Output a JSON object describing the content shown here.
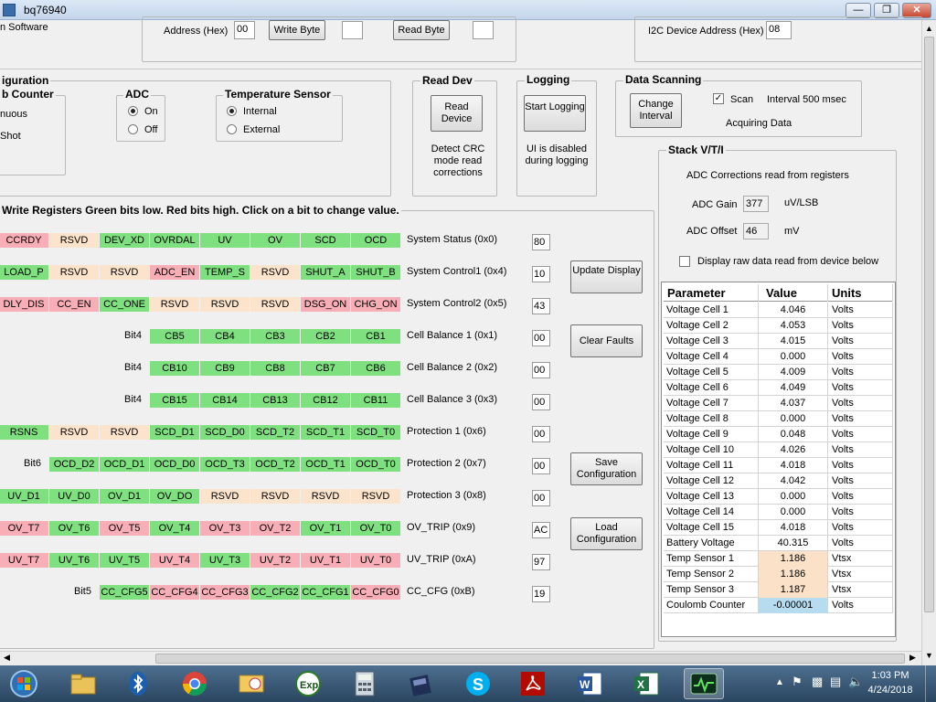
{
  "window": {
    "title": "bq76940"
  },
  "top": {
    "left_clip": "n Software",
    "address_label": "Address (Hex)",
    "address_value": "00",
    "write_byte": "Write Byte",
    "write_value": "",
    "read_byte": "Read Byte",
    "read_value": "",
    "i2c_label": "I2C Device Address (Hex)",
    "i2c_value": "08"
  },
  "config": {
    "legend": "iguration",
    "counter_legend": "b Counter",
    "counter_opt1": "nuous",
    "counter_opt2": "Shot",
    "adc_legend": "ADC",
    "adc_on": "On",
    "adc_off": "Off",
    "temp_legend": "Temperature Sensor",
    "temp_internal": "Internal",
    "temp_external": "External"
  },
  "read_dev": {
    "legend": "Read Dev",
    "button": "Read Device",
    "note": "Detect CRC mode read corrections"
  },
  "logging": {
    "legend": "Logging",
    "button": "Start Logging",
    "note": "UI is disabled during logging"
  },
  "scanning": {
    "legend": "Data Scanning",
    "button": "Change Interval",
    "scan_label": "Scan",
    "interval": "Interval 500 msec",
    "status": "Acquiring Data"
  },
  "registers": {
    "header": "Write Registers   Green bits low.  Red bits high.  Click on a bit to change value.",
    "rows": [
      {
        "name": "System Status (0x0)",
        "value": "80",
        "bits": [
          [
            "CCRDY",
            "r"
          ],
          [
            "RSVD",
            "p"
          ],
          [
            "DEV_XD",
            "g"
          ],
          [
            "OVRDAL",
            "g"
          ],
          [
            "UV",
            "g"
          ],
          [
            "OV",
            "g"
          ],
          [
            "SCD",
            "g"
          ],
          [
            "OCD",
            "g"
          ]
        ]
      },
      {
        "name": "System Control1 (0x4)",
        "value": "10",
        "bits": [
          [
            "LOAD_P",
            "g"
          ],
          [
            "RSVD",
            "p"
          ],
          [
            "RSVD",
            "p"
          ],
          [
            "ADC_EN",
            "r"
          ],
          [
            "TEMP_S",
            "g"
          ],
          [
            "RSVD",
            "p"
          ],
          [
            "SHUT_A",
            "g"
          ],
          [
            "SHUT_B",
            "g"
          ]
        ]
      },
      {
        "name": "System Control2 (0x5)",
        "value": "43",
        "bits": [
          [
            "DLY_DIS",
            "r"
          ],
          [
            "CC_EN",
            "r"
          ],
          [
            "CC_ONE",
            "g"
          ],
          [
            "RSVD",
            "p"
          ],
          [
            "RSVD",
            "p"
          ],
          [
            "RSVD",
            "p"
          ],
          [
            "DSG_ON",
            "r"
          ],
          [
            "CHG_ON",
            "r"
          ]
        ]
      },
      {
        "name": "Cell Balance 1 (0x1)",
        "value": "00",
        "prefix": "Bit4",
        "bits": [
          [
            "CB5",
            "g"
          ],
          [
            "CB4",
            "g"
          ],
          [
            "CB3",
            "g"
          ],
          [
            "CB2",
            "g"
          ],
          [
            "CB1",
            "g"
          ]
        ]
      },
      {
        "name": "Cell Balance 2 (0x2)",
        "value": "00",
        "prefix": "Bit4",
        "bits": [
          [
            "CB10",
            "g"
          ],
          [
            "CB9",
            "g"
          ],
          [
            "CB8",
            "g"
          ],
          [
            "CB7",
            "g"
          ],
          [
            "CB6",
            "g"
          ]
        ]
      },
      {
        "name": "Cell Balance 3 (0x3)",
        "value": "00",
        "prefix": "Bit4",
        "bits": [
          [
            "CB15",
            "g"
          ],
          [
            "CB14",
            "g"
          ],
          [
            "CB13",
            "g"
          ],
          [
            "CB12",
            "g"
          ],
          [
            "CB11",
            "g"
          ]
        ]
      },
      {
        "name": "Protection 1 (0x6)",
        "value": "00",
        "bits": [
          [
            "RSNS",
            "g"
          ],
          [
            "RSVD",
            "p"
          ],
          [
            "RSVD",
            "p"
          ],
          [
            "SCD_D1",
            "g"
          ],
          [
            "SCD_D0",
            "g"
          ],
          [
            "SCD_T2",
            "g"
          ],
          [
            "SCD_T1",
            "g"
          ],
          [
            "SCD_T0",
            "g"
          ]
        ]
      },
      {
        "name": "Protection 2 (0x7)",
        "value": "00",
        "prefix": "Bit6",
        "bits": [
          [
            "OCD_D2",
            "g"
          ],
          [
            "OCD_D1",
            "g"
          ],
          [
            "OCD_D0",
            "g"
          ],
          [
            "OCD_T3",
            "g"
          ],
          [
            "OCD_T2",
            "g"
          ],
          [
            "OCD_T1",
            "g"
          ],
          [
            "OCD_T0",
            "g"
          ]
        ]
      },
      {
        "name": "Protection 3 (0x8)",
        "value": "00",
        "bits": [
          [
            "UV_D1",
            "g"
          ],
          [
            "UV_D0",
            "g"
          ],
          [
            "OV_D1",
            "g"
          ],
          [
            "OV_DO",
            "g"
          ],
          [
            "RSVD",
            "p"
          ],
          [
            "RSVD",
            "p"
          ],
          [
            "RSVD",
            "p"
          ],
          [
            "RSVD",
            "p"
          ]
        ]
      },
      {
        "name": "OV_TRIP (0x9)",
        "value": "AC",
        "bits": [
          [
            "OV_T7",
            "r"
          ],
          [
            "OV_T6",
            "g"
          ],
          [
            "OV_T5",
            "r"
          ],
          [
            "OV_T4",
            "g"
          ],
          [
            "OV_T3",
            "r"
          ],
          [
            "OV_T2",
            "r"
          ],
          [
            "OV_T1",
            "g"
          ],
          [
            "OV_T0",
            "g"
          ]
        ]
      },
      {
        "name": "UV_TRIP (0xA)",
        "value": "97",
        "bits": [
          [
            "UV_T7",
            "r"
          ],
          [
            "UV_T6",
            "g"
          ],
          [
            "UV_T5",
            "g"
          ],
          [
            "UV_T4",
            "r"
          ],
          [
            "UV_T3",
            "g"
          ],
          [
            "UV_T2",
            "r"
          ],
          [
            "UV_T1",
            "r"
          ],
          [
            "UV_T0",
            "r"
          ]
        ]
      },
      {
        "name": "CC_CFG (0xB)",
        "value": "19",
        "prefix": "Bit5",
        "bits": [
          [
            "CC_CFG5",
            "g"
          ],
          [
            "CC_CFG4",
            "r"
          ],
          [
            "CC_CFG3",
            "r"
          ],
          [
            "CC_CFG2",
            "g"
          ],
          [
            "CC_CFG1",
            "g"
          ],
          [
            "CC_CFG0",
            "r"
          ]
        ]
      }
    ]
  },
  "buttons": {
    "update_display": "Update Display",
    "clear_faults": "Clear Faults",
    "save_config": "Save Configuration",
    "load_config": "Load Configuration"
  },
  "stack": {
    "legend": "Stack V/T/I",
    "note": "ADC Corrections read from registers",
    "gain_label": "ADC Gain",
    "gain_value": "377",
    "gain_unit": "uV/LSB",
    "offset_label": "ADC Offset",
    "offset_value": "46",
    "offset_unit": "mV",
    "raw_label": "Display raw data read from device below"
  },
  "table": {
    "headers": [
      "Parameter",
      "Value",
      "Units"
    ],
    "rows": [
      [
        "Voltage Cell 1",
        "4.046",
        "Volts",
        ""
      ],
      [
        "Voltage Cell 2",
        "4.053",
        "Volts",
        ""
      ],
      [
        "Voltage Cell 3",
        "4.015",
        "Volts",
        ""
      ],
      [
        "Voltage Cell 4",
        "0.000",
        "Volts",
        ""
      ],
      [
        "Voltage Cell 5",
        "4.009",
        "Volts",
        ""
      ],
      [
        "Voltage Cell 6",
        "4.049",
        "Volts",
        ""
      ],
      [
        "Voltage Cell 7",
        "4.037",
        "Volts",
        ""
      ],
      [
        "Voltage Cell 8",
        "0.000",
        "Volts",
        ""
      ],
      [
        "Voltage Cell 9",
        "0.048",
        "Volts",
        ""
      ],
      [
        "Voltage Cell 10",
        "4.026",
        "Volts",
        ""
      ],
      [
        "Voltage Cell 11",
        "4.018",
        "Volts",
        ""
      ],
      [
        "Voltage Cell 12",
        "4.042",
        "Volts",
        ""
      ],
      [
        "Voltage Cell 13",
        "0.000",
        "Volts",
        ""
      ],
      [
        "Voltage Cell 14",
        "0.000",
        "Volts",
        ""
      ],
      [
        "Voltage Cell 15",
        "4.018",
        "Volts",
        ""
      ],
      [
        "Battery Voltage",
        "40.315",
        "Volts",
        ""
      ],
      [
        "Temp Sensor 1",
        "1.186",
        "Vtsx",
        "#fbe1c8"
      ],
      [
        "Temp Sensor 2",
        "1.186",
        "Vtsx",
        "#fbe1c8"
      ],
      [
        "Temp Sensor 3",
        "1.187",
        "Vtsx",
        "#fbe1c8"
      ],
      [
        "Coulomb Counter",
        "-0.00001",
        "Volts",
        "#b7dcef"
      ]
    ]
  },
  "taskbar": {
    "time": "1:03 PM",
    "date": "4/24/2018",
    "apps": [
      "start-orb-icon",
      "explorer-icon",
      "bluetooth-icon",
      "chrome-icon",
      "outlook-icon",
      "exp-app-icon",
      "calculator-icon",
      "elf-app-icon",
      "skype-icon",
      "acrobat-icon",
      "word-icon",
      "excel-icon",
      "bq-evm-icon"
    ]
  },
  "colors": {
    "green": "#7fe07f",
    "red": "#f7aeb6",
    "peach": "#fce3cc"
  }
}
